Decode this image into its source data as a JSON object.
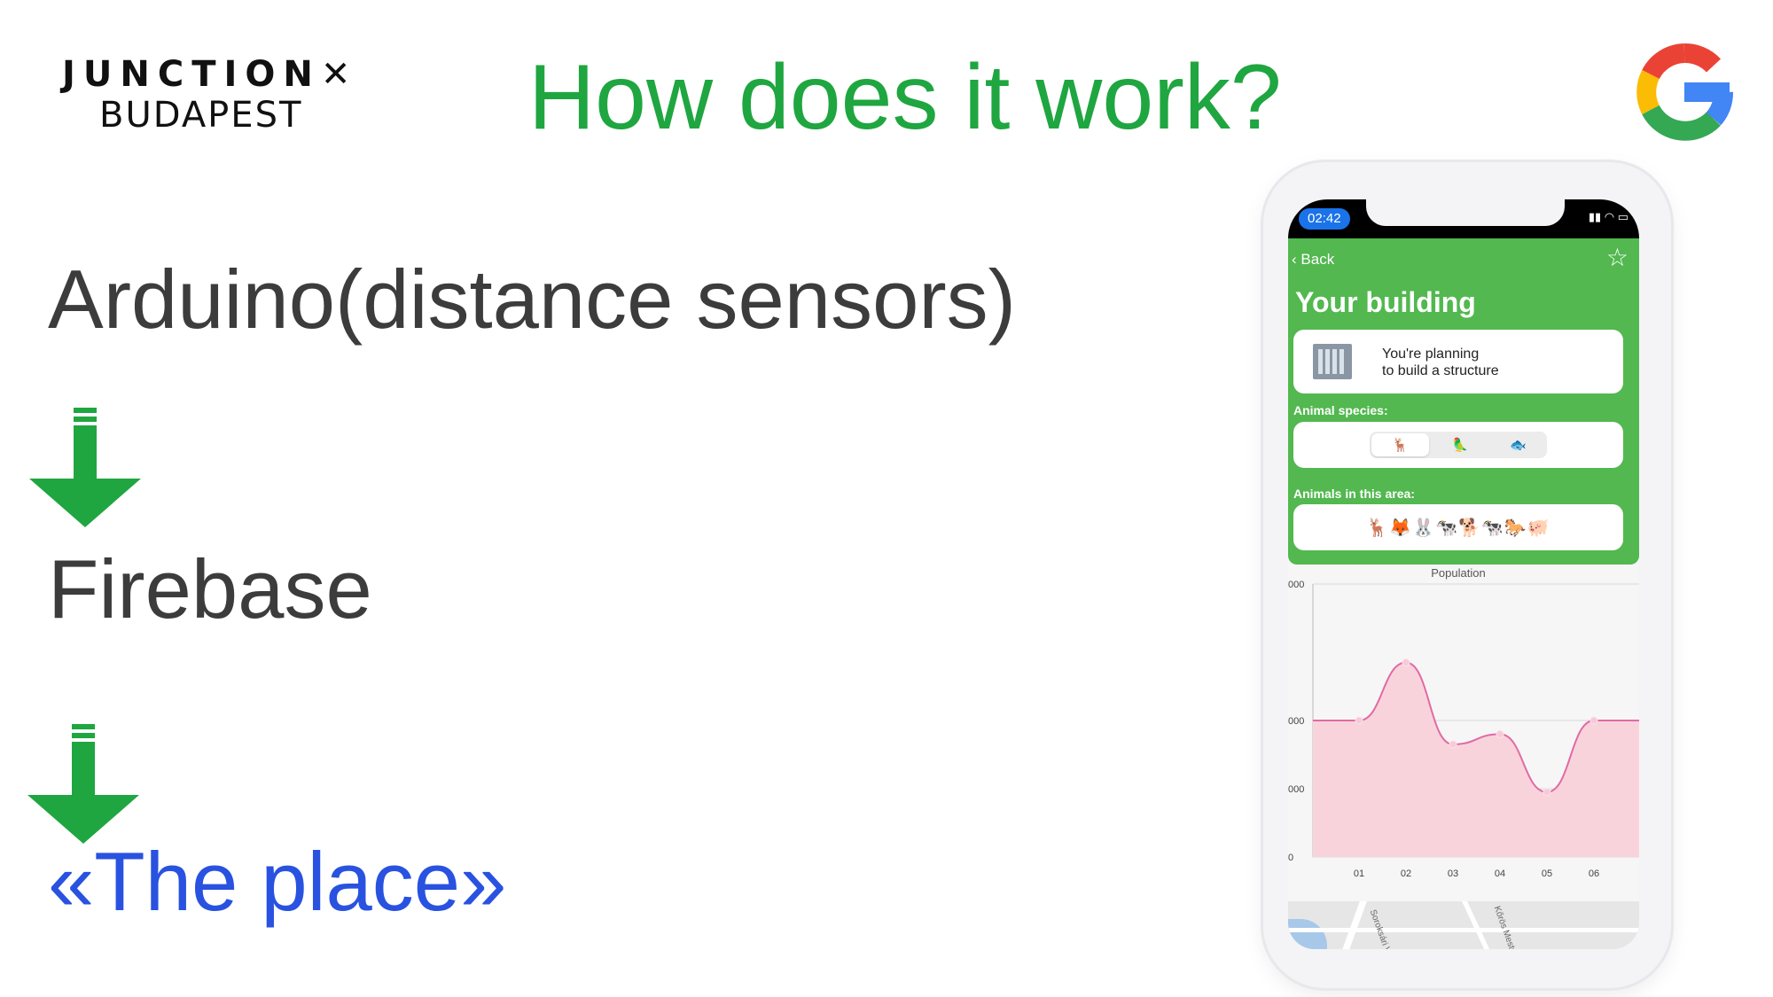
{
  "logo": {
    "line1": "JUNCTION✕",
    "line2": "BUDAPEST"
  },
  "title": "How does it work?",
  "steps": [
    {
      "label": "Arduino(distance sensors)"
    },
    {
      "label": "Firebase"
    },
    {
      "label": "«The place»"
    }
  ],
  "colors": {
    "title": "#1fa640",
    "arrow": "#1fa640",
    "highlight": "#2952e0",
    "app_green": "#52b84f",
    "chart_line": "#e16aa4",
    "chart_fill": "#f9d3dc"
  },
  "phone": {
    "time": "02:42",
    "back_label": "Back",
    "panel_title": "Your building",
    "card_text_1": "You're planning",
    "card_text_2": "to build a structure",
    "species_label": "Animal species:",
    "species_options": [
      "🦌",
      "🦜",
      "🐟"
    ],
    "animals_label": "Animals in this area:",
    "animals": "🦌🦊🐰🐄🐕🐄🐎🐖",
    "map_label_1": "Soroksári Way",
    "map_label_2": "Kőrös Mester St"
  },
  "chart_data": {
    "type": "area",
    "title": "Population",
    "categories": [
      "01",
      "02",
      "03",
      "04",
      "05",
      "06"
    ],
    "y_tick_labels": [
      "000",
      "000",
      "000",
      "0"
    ],
    "values": [
      2000,
      2850,
      1650,
      1800,
      950,
      2000
    ],
    "ylim": [
      0,
      4000
    ],
    "grid": true
  }
}
